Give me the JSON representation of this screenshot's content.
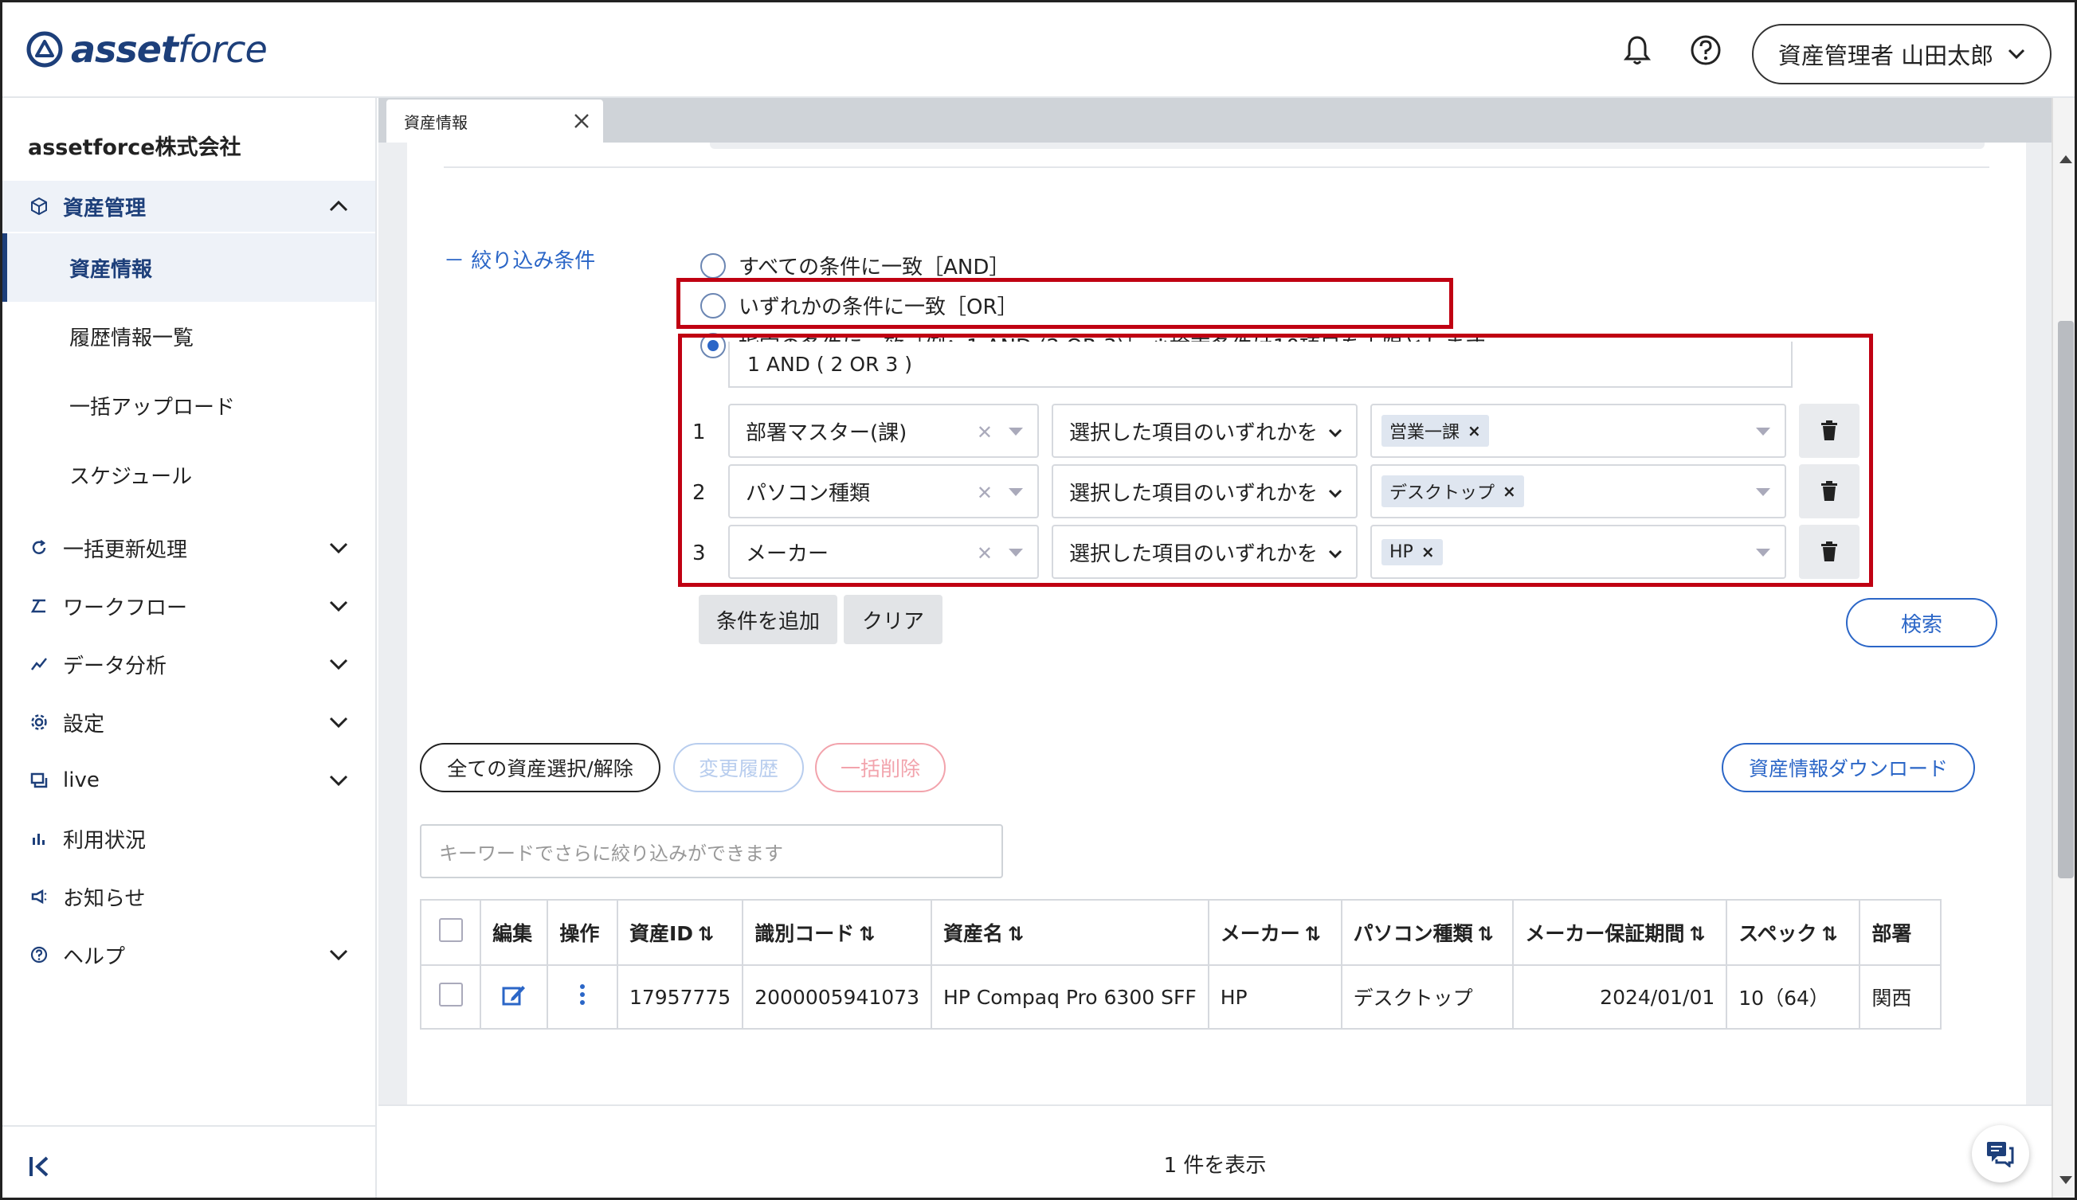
{
  "header": {
    "logo_bold": "asset",
    "logo_light": "force",
    "user_label": "資産管理者 山田太郎"
  },
  "sidebar": {
    "company": "assetforce株式会社",
    "group_label": "資産管理",
    "sub_items": [
      "資産情報",
      "履歴情報一覧",
      "一括アップロード",
      "スケジュール"
    ],
    "items": [
      {
        "label": "一括更新処理",
        "icon": "refresh-icon",
        "has_chevron": true
      },
      {
        "label": "ワークフロー",
        "icon": "workflow-icon",
        "has_chevron": true
      },
      {
        "label": "データ分析",
        "icon": "chart-icon",
        "has_chevron": true
      },
      {
        "label": "設定",
        "icon": "gear-icon",
        "has_chevron": true
      },
      {
        "label": "live",
        "icon": "chat-icon",
        "has_chevron": true
      },
      {
        "label": "利用状況",
        "icon": "bar-chart-icon",
        "has_chevron": false
      },
      {
        "label": "お知らせ",
        "icon": "megaphone-icon",
        "has_chevron": false
      },
      {
        "label": "ヘルプ",
        "icon": "help-icon",
        "has_chevron": true
      }
    ]
  },
  "tab": {
    "label": "資産情報"
  },
  "filter": {
    "label": "－ 絞り込み条件",
    "options": [
      "すべての条件に一致［AND］",
      "いずれかの条件に一致［OR］",
      "指定の条件に一致［例：1 AND (2 OR 3)］ ※検索条件は10項目を上限とします"
    ],
    "selected_index": 2,
    "expression": "1 AND ( 2 OR 3 )",
    "conditions": [
      {
        "num": "1",
        "field": "部署マスター(課)",
        "operator": "選択した項目のいずれかを",
        "value": "営業一課"
      },
      {
        "num": "2",
        "field": "パソコン種類",
        "operator": "選択した項目のいずれかを",
        "value": "デスクトップ"
      },
      {
        "num": "3",
        "field": "メーカー",
        "operator": "選択した項目のいずれかを",
        "value": "HP"
      }
    ],
    "add_label": "条件を追加",
    "clear_label": "クリア",
    "search_label": "検索"
  },
  "list": {
    "select_all_label": "全ての資産選択/解除",
    "history_label": "変更履歴",
    "bulk_delete_label": "一括削除",
    "download_label": "資産情報ダウンロード",
    "keyword_placeholder": "キーワードでさらに絞り込みができます",
    "columns": [
      "編集",
      "操作",
      "資産ID",
      "識別コード",
      "資産名",
      "メーカー",
      "パソコン種類",
      "メーカー保証期間",
      "スペック",
      "部署"
    ],
    "rows": [
      {
        "asset_id": "17957775",
        "code": "2000005941073",
        "name": "HP Compaq Pro 6300 SFF",
        "maker": "HP",
        "pc_type": "デスクトップ",
        "warranty": "2024/01/01",
        "spec": "10（64）",
        "dept": "関西"
      }
    ],
    "count_label": "1 件を表示"
  },
  "colors": {
    "brand": "#1d3f7a",
    "accent": "#2b66c7",
    "highlight": "#c00012",
    "danger_light": "#f2a3ac"
  }
}
